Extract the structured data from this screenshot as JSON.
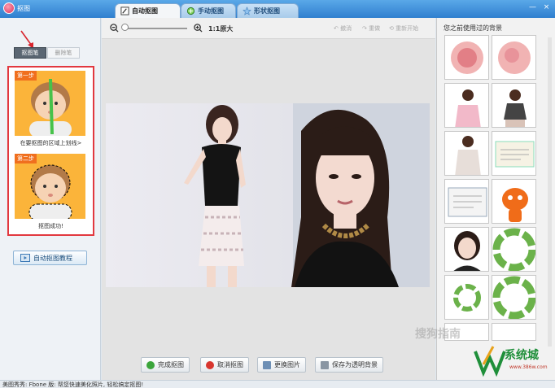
{
  "window": {
    "title": "抠图",
    "close_label": "×",
    "minimize_label": "—"
  },
  "tabs": [
    {
      "label": "自动抠图",
      "icon": "brush-icon"
    },
    {
      "label": "手动抠图",
      "icon": "lasso-icon"
    },
    {
      "label": "形状抠图",
      "icon": "shape-icon"
    }
  ],
  "left": {
    "modes": {
      "brush": "抠图笔",
      "erase": "删除笔"
    },
    "tutorial": {
      "step1_badge": "第一步",
      "step1_caption": "在要抠图的区域上划线>",
      "step2_badge": "第二步",
      "step2_caption": "抠图成功!"
    },
    "tutorial_button": "自动抠图教程"
  },
  "toolbar": {
    "original_size": "1:1原大",
    "undo": "撤消",
    "redo": "重做",
    "reset": "重新开始"
  },
  "bottom": {
    "done": "完成抠图",
    "cancel": "取消抠图",
    "replace": "更换图片",
    "save": "保存为透明背景"
  },
  "right": {
    "title": "您之前使用过的背景"
  },
  "status": {
    "text": "美图秀秀: Fbone 版: 帮您快速美化照片, 轻松搞定抠图!"
  },
  "watermarks": {
    "sogou": "搜狗指南",
    "brand": "系统城",
    "site": "www.386w.com"
  }
}
